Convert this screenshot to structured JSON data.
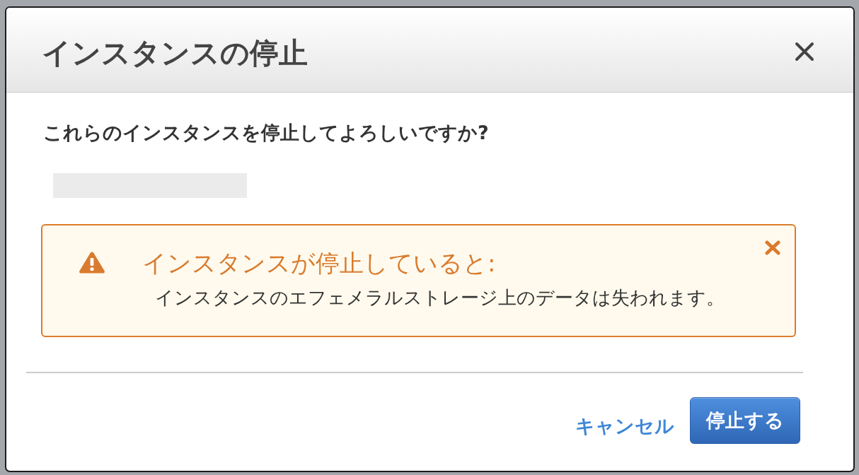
{
  "dialog": {
    "title": "インスタンスの停止"
  },
  "question": "これらのインスタンスを停止してよろしいですか?",
  "alert": {
    "kind": "warning",
    "title": "インスタンスが停止していると:",
    "message": "インスタンスのエフェメラルストレージ上のデータは失われます。"
  },
  "buttons": [
    {
      "kind": "link",
      "label": "キャンセル"
    },
    {
      "kind": "primary",
      "label": "停止する"
    }
  ]
}
